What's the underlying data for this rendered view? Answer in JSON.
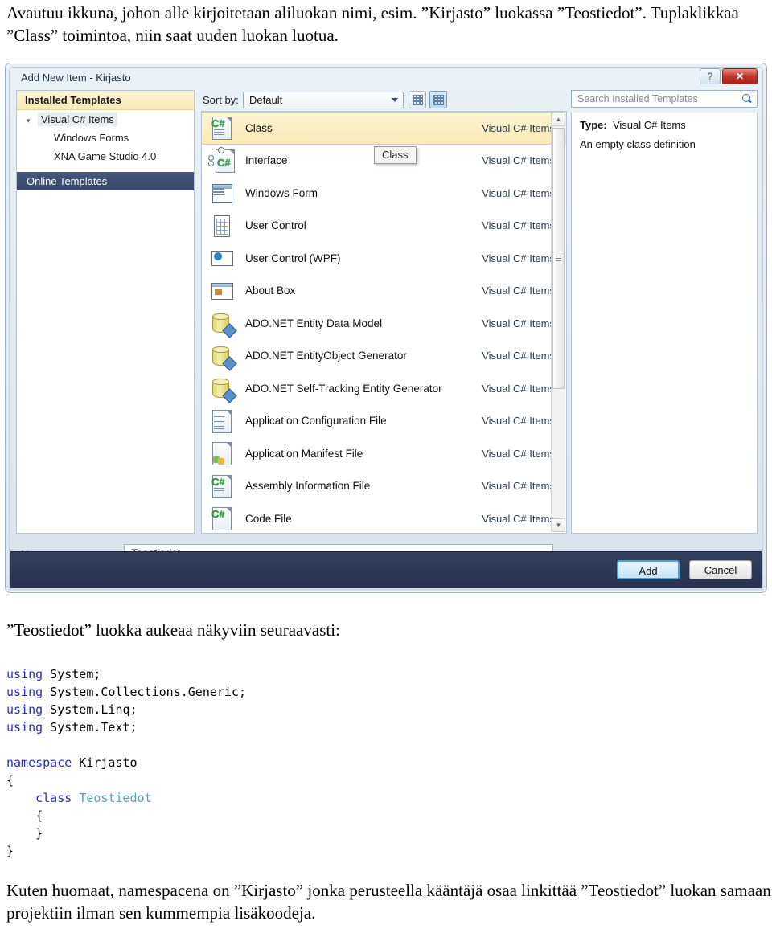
{
  "document": {
    "intro_paragraph": "Avautuu ikkuna, johon alle kirjoitetaan aliluokan nimi, esim. ”Kirjasto” luokassa ”Teostiedot”. Tuplaklikkaa ”Class” toimintoa, niin saat uuden luokan luotua.",
    "mid_heading": "”Teostiedot” luokka aukeaa näkyviin seuraavasti:",
    "closing_paragraph": "Kuten huomaat, namespacena on ”Kirjasto” jonka perusteella kääntäjä osaa linkittää ”Teostiedot” luokan samaan projektiin ilman sen kummempia lisäkoodeja."
  },
  "code": {
    "lines": [
      [
        {
          "t": "using",
          "c": "kw"
        },
        {
          "t": " System;",
          "c": ""
        }
      ],
      [
        {
          "t": "using",
          "c": "kw"
        },
        {
          "t": " System.Collections.Generic;",
          "c": ""
        }
      ],
      [
        {
          "t": "using",
          "c": "kw"
        },
        {
          "t": " System.Linq;",
          "c": ""
        }
      ],
      [
        {
          "t": "using",
          "c": "kw"
        },
        {
          "t": " System.Text;",
          "c": ""
        }
      ],
      [
        {
          "t": "",
          "c": ""
        }
      ],
      [
        {
          "t": "namespace",
          "c": "kw"
        },
        {
          "t": " Kirjasto",
          "c": ""
        }
      ],
      [
        {
          "t": "{",
          "c": ""
        }
      ],
      [
        {
          "t": "    ",
          "c": ""
        },
        {
          "t": "class",
          "c": "kw"
        },
        {
          "t": " ",
          "c": ""
        },
        {
          "t": "Teostiedot",
          "c": "typ"
        }
      ],
      [
        {
          "t": "    {",
          "c": ""
        }
      ],
      [
        {
          "t": "    }",
          "c": ""
        }
      ],
      [
        {
          "t": "}",
          "c": ""
        }
      ]
    ],
    "colors": {
      "keyword": "#2b2bbf",
      "type": "#4fa3b8",
      "text": "#000000"
    }
  },
  "dialog": {
    "title": "Add New Item - Kirjasto",
    "help_button_label": "?",
    "close_button_label": "✕",
    "tree": {
      "header": "Installed Templates",
      "items": [
        {
          "label": "Visual C# Items",
          "level": 0,
          "expanded": true,
          "selected": true
        },
        {
          "label": "Windows Forms",
          "level": 1,
          "expanded": false,
          "selected": false
        },
        {
          "label": "XNA Game Studio 4.0",
          "level": 1,
          "expanded": false,
          "selected": false
        }
      ],
      "online_templates": "Online Templates"
    },
    "toolbar": {
      "sort_by_label": "Sort by:",
      "sort_by_value": "Default",
      "view_small_icons": "small-icons-view",
      "view_large_icons": "large-icons-view"
    },
    "tooltip": "Class",
    "search": {
      "placeholder": "Search Installed Templates",
      "value": ""
    },
    "details": {
      "type_label": "Type:",
      "type_value": "Visual C# Items",
      "description": "An empty class definition"
    },
    "templates": [
      {
        "name": "Class",
        "category": "Visual C# Items",
        "icon": "cs-class-icon",
        "selected": true
      },
      {
        "name": "Interface",
        "category": "Visual C# Items",
        "icon": "cs-interface-icon",
        "selected": false
      },
      {
        "name": "Windows Form",
        "category": "Visual C# Items",
        "icon": "windows-form-icon",
        "selected": false
      },
      {
        "name": "User Control",
        "category": "Visual C# Items",
        "icon": "user-control-icon",
        "selected": false
      },
      {
        "name": "User Control (WPF)",
        "category": "Visual C# Items",
        "icon": "user-control-wpf-icon",
        "selected": false
      },
      {
        "name": "About Box",
        "category": "Visual C# Items",
        "icon": "about-box-icon",
        "selected": false
      },
      {
        "name": "ADO.NET Entity Data Model",
        "category": "Visual C# Items",
        "icon": "database-icon",
        "selected": false
      },
      {
        "name": "ADO.NET EntityObject Generator",
        "category": "Visual C# Items",
        "icon": "database-icon",
        "selected": false
      },
      {
        "name": "ADO.NET Self-Tracking Entity Generator",
        "category": "Visual C# Items",
        "icon": "database-icon",
        "selected": false
      },
      {
        "name": "Application Configuration File",
        "category": "Visual C# Items",
        "icon": "config-file-icon",
        "selected": false
      },
      {
        "name": "Application Manifest File",
        "category": "Visual C# Items",
        "icon": "manifest-file-icon",
        "selected": false
      },
      {
        "name": "Assembly Information File",
        "category": "Visual C# Items",
        "icon": "cs-assembly-icon",
        "selected": false
      },
      {
        "name": "Code File",
        "category": "Visual C# Items",
        "icon": "cs-code-file-icon",
        "selected": false
      }
    ],
    "name_field": {
      "label": "Name:",
      "label_accel": "N",
      "label_rest": "ame:",
      "value": "Teostiedot"
    },
    "footer": {
      "add_label": "Add",
      "cancel_label": "Cancel"
    },
    "colors": {
      "selection_gold": "#fbe9b6",
      "footer_navy": "#273350",
      "accent_blue": "#4aa3e0",
      "close_red": "#c0342b"
    }
  }
}
